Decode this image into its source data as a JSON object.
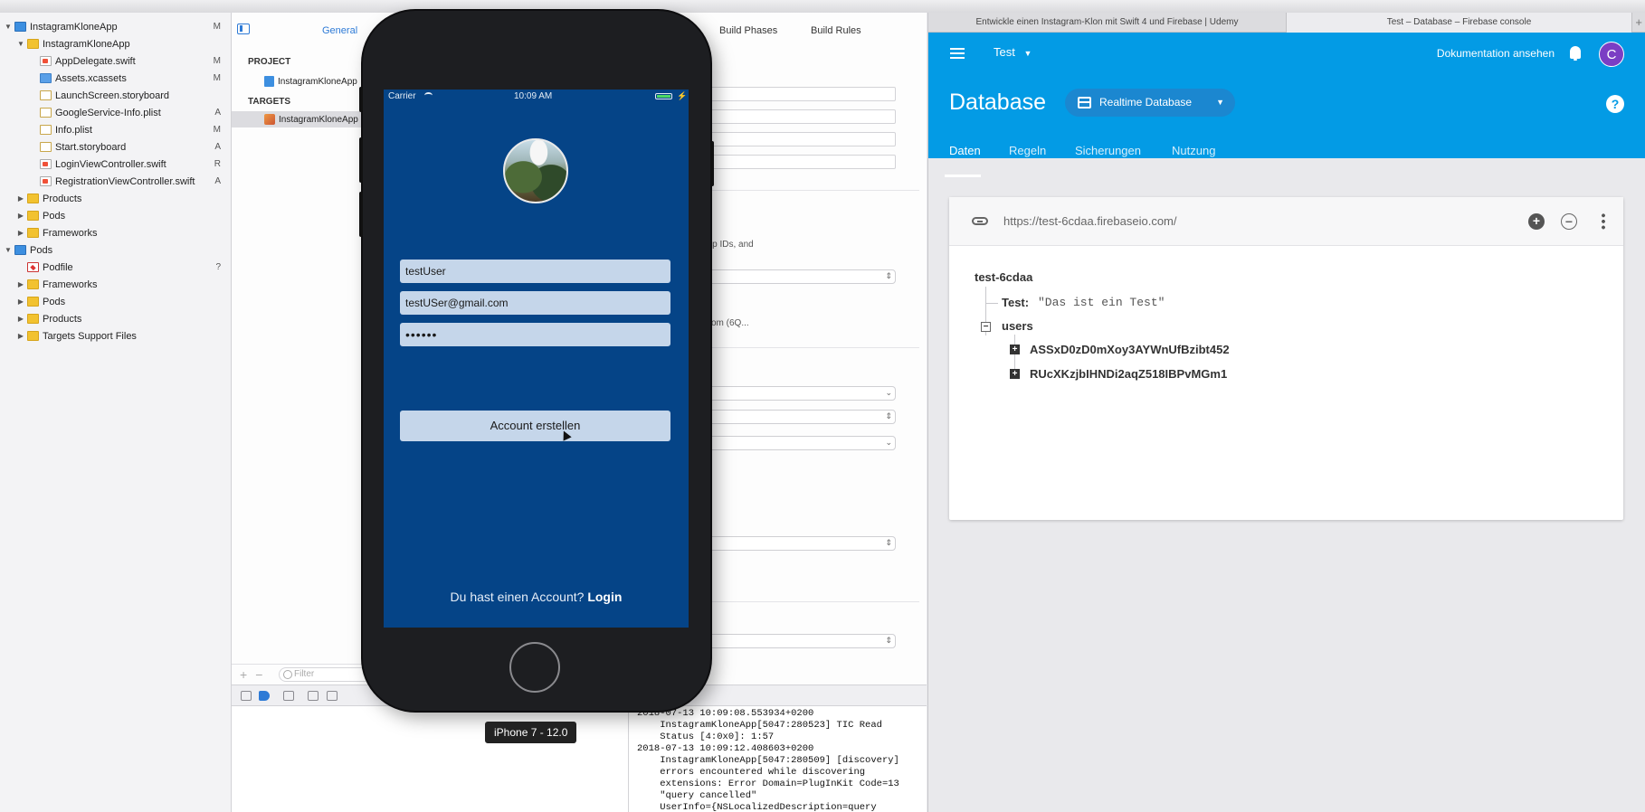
{
  "xcode": {
    "navigator": {
      "items": [
        {
          "label": "InstagramKloneApp",
          "badge": "M",
          "type": "proj",
          "depth": 0,
          "open": true
        },
        {
          "label": "InstagramKloneApp",
          "badge": "",
          "type": "folder",
          "depth": 1,
          "open": true
        },
        {
          "label": "AppDelegate.swift",
          "badge": "M",
          "type": "swift",
          "depth": 2
        },
        {
          "label": "Assets.xcassets",
          "badge": "M",
          "type": "xcassets",
          "depth": 2
        },
        {
          "label": "LaunchScreen.storyboard",
          "badge": "",
          "type": "doc",
          "depth": 2
        },
        {
          "label": "GoogleService-Info.plist",
          "badge": "A",
          "type": "doc",
          "depth": 2
        },
        {
          "label": "Info.plist",
          "badge": "M",
          "type": "doc",
          "depth": 2
        },
        {
          "label": "Start.storyboard",
          "badge": "A",
          "type": "doc",
          "depth": 2
        },
        {
          "label": "LoginViewController.swift",
          "badge": "R",
          "type": "swift",
          "depth": 2
        },
        {
          "label": "RegistrationViewController.swift",
          "badge": "A",
          "type": "swift",
          "depth": 2
        },
        {
          "label": "Products",
          "badge": "",
          "type": "folder",
          "depth": 1,
          "open": false
        },
        {
          "label": "Pods",
          "badge": "",
          "type": "folder",
          "depth": 1,
          "open": false
        },
        {
          "label": "Frameworks",
          "badge": "",
          "type": "folder",
          "depth": 1,
          "open": false
        },
        {
          "label": "Pods",
          "badge": "",
          "type": "proj",
          "depth": 0,
          "open": true
        },
        {
          "label": "Podfile",
          "badge": "?",
          "type": "ruby",
          "depth": 1
        },
        {
          "label": "Frameworks",
          "badge": "",
          "type": "folder",
          "depth": 1,
          "open": false
        },
        {
          "label": "Pods",
          "badge": "",
          "type": "folder",
          "depth": 1,
          "open": false
        },
        {
          "label": "Products",
          "badge": "",
          "type": "folder",
          "depth": 1,
          "open": false
        },
        {
          "label": "Targets Support Files",
          "badge": "",
          "type": "folder",
          "depth": 1,
          "open": false
        }
      ]
    },
    "editor": {
      "tabs": {
        "general": "General",
        "build_phases": "Build Phases",
        "build_rules": "Build Rules"
      },
      "project_header": "PROJECT",
      "project_item": "InstagramKloneApp",
      "targets_header": "TARGETS",
      "target_item": "InstagramKloneApp",
      "partial_text_1": "app IDs, and",
      "partial_text_2": "l.com (6Q...",
      "filter_placeholder": "Filter"
    },
    "console": {
      "lines": [
        "2018-07-13 10:09:08.553934+0200",
        "    InstagramKloneApp[5047:280523] TIC Read",
        "    Status [4:0x0]: 1:57",
        "2018-07-13 10:09:12.408603+0200",
        "    InstagramKloneApp[5047:280509] [discovery]",
        "    errors encountered while discovering",
        "    extensions: Error Domain=PlugInKit Code=13",
        "    \"query cancelled\"",
        "    UserInfo={NSLocalizedDescription=query"
      ]
    }
  },
  "simulator": {
    "status": {
      "carrier": "Carrier",
      "time": "10:09 AM"
    },
    "username_value": "testUser",
    "email_value": "testUSer@gmail.com",
    "password_value": "••••••",
    "create_button": "Account erstellen",
    "login_prompt": "Du hast einen Account?",
    "login_link": "Login",
    "device_label": "iPhone 7 - 12.0"
  },
  "browser": {
    "tabs": [
      {
        "label": "Entwickle einen Instagram-Klon mit Swift 4 und Firebase | Udemy",
        "active": false
      },
      {
        "label": "Test – Database – Firebase console",
        "active": true
      }
    ],
    "new_tab": "+"
  },
  "firebase": {
    "project": "Test",
    "docs_link": "Dokumentation ansehen",
    "account_initial": "C",
    "page_title": "Database",
    "db_type": "Realtime Database",
    "help": "?",
    "tabs": [
      "Daten",
      "Regeln",
      "Sicherungen",
      "Nutzung"
    ],
    "active_tab": "Daten",
    "url": "https://test-6cdaa.firebaseio.com/",
    "tree": {
      "root": "test-6cdaa",
      "test_key": "Test:",
      "test_value": "\"Das ist ein Test\"",
      "users_key": "users",
      "user_ids": [
        "ASSxD0zD0mXoy3AYWnUfBzibt452",
        "RUcXKzjbIHNDi2aqZ518IBPvMGm1"
      ]
    },
    "colors": {
      "header": "#039be5",
      "account": "#7b3ec4"
    }
  }
}
